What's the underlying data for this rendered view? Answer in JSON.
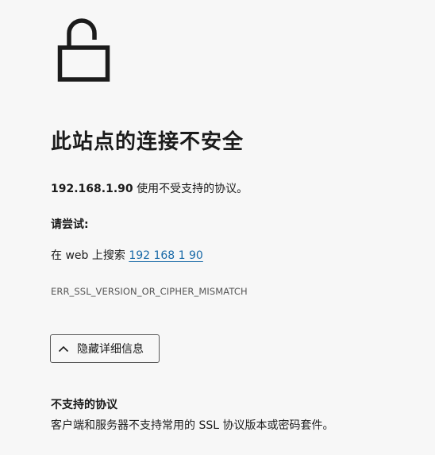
{
  "icon": "lock-open-icon",
  "heading": "此站点的连接不安全",
  "description": {
    "host": "192.168.1.90",
    "message": " 使用不受支持的协议。"
  },
  "suggestions": {
    "label": "请尝试:",
    "search_prefix": "在 web 上搜索 ",
    "search_link": "192 168 1 90"
  },
  "error_code": "ERR_SSL_VERSION_OR_CIPHER_MISMATCH",
  "details_button": {
    "label": "隐藏详细信息",
    "icon": "chevron-up-icon"
  },
  "details": {
    "title": "不支持的协议",
    "body": "客户端和服务器不支持常用的 SSL 协议版本或密码套件。"
  },
  "colors": {
    "background": "#f7f7f7",
    "text": "#1b1b1b",
    "link": "#1a6aa8"
  }
}
